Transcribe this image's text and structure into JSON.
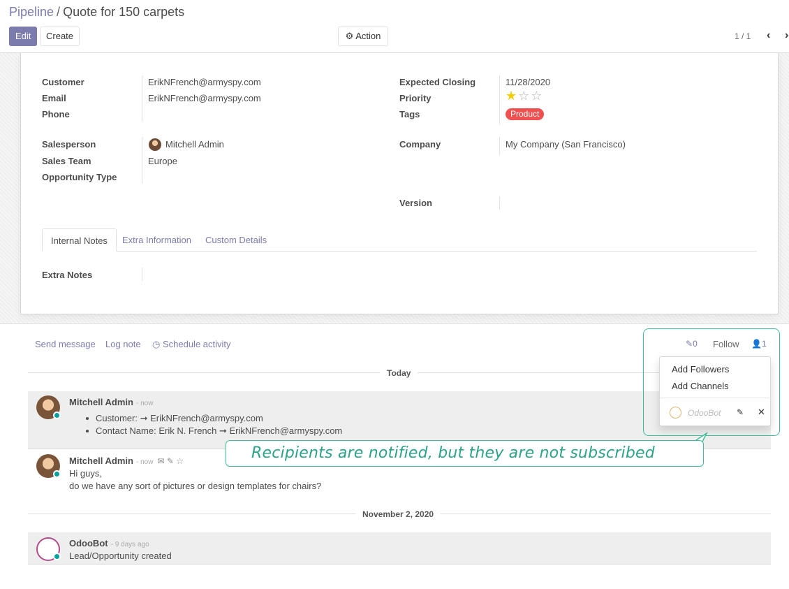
{
  "breadcrumb": {
    "parent": "Pipeline",
    "separator": "/",
    "current": "Quote for 150 carpets"
  },
  "toolbar": {
    "edit_label": "Edit",
    "create_label": "Create",
    "action_label": "Action",
    "pager": "1 / 1"
  },
  "form": {
    "customer_label": "Customer",
    "customer_value": "ErikNFrench@armyspy.com",
    "email_label": "Email",
    "email_value": "ErikNFrench@armyspy.com",
    "phone_label": "Phone",
    "expected_closing_label": "Expected Closing",
    "expected_closing_value": "11/28/2020",
    "priority_label": "Priority",
    "priority_stars": 1,
    "tags_label": "Tags",
    "tag": "Product",
    "salesperson_label": "Salesperson",
    "salesperson_value": "Mitchell Admin",
    "sales_team_label": "Sales Team",
    "sales_team_value": "Europe",
    "opportunity_type_label": "Opportunity Type",
    "company_label": "Company",
    "company_value": "My Company (San Francisco)",
    "version_label": "Version",
    "extra_notes_label": "Extra Notes"
  },
  "tabs": [
    {
      "label": "Internal Notes",
      "active": true
    },
    {
      "label": "Extra Information",
      "active": false
    },
    {
      "label": "Custom Details",
      "active": false
    }
  ],
  "chatter": {
    "send_message": "Send message",
    "log_note": "Log note",
    "schedule_activity": "Schedule activity",
    "attachments_count": "0",
    "follow_label": "Follow",
    "followers_count": "1",
    "date_today": "Today",
    "date_nov": "November 2, 2020",
    "messages": [
      {
        "author": "Mitchell Admin",
        "date": "- now",
        "tracking": [
          "Customer: ➞ ErikNFrench@armyspy.com",
          "Contact Name: Erik N. French ➞ ErikNFrench@armyspy.com"
        ]
      },
      {
        "author": "Mitchell Admin",
        "date": "- now",
        "lines": [
          "Hi guys,",
          "do we have any sort of pictures or design templates for chairs?"
        ]
      },
      {
        "author": "OdooBot",
        "date": "- 9 days ago",
        "lines": [
          "Lead/Opportunity created"
        ]
      }
    ]
  },
  "followers_dropdown": {
    "add_followers": "Add Followers",
    "add_channels": "Add Channels",
    "follower_name": "OdooBot"
  },
  "callout": {
    "text": "Recipients are notified, but they are not subscribed"
  },
  "colors": {
    "primary": "#7c7bad",
    "highlight": "#3fbd9b",
    "tag": "#f05050",
    "presence": "#00a09d"
  }
}
